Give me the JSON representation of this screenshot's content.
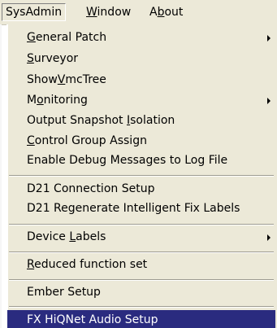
{
  "menubar": {
    "sysadmin": {
      "pre": "SysAdmin",
      "u": "",
      "post": ""
    },
    "window": {
      "pre": "",
      "u": "W",
      "post": "indow"
    },
    "about": {
      "pre": "A",
      "u": "b",
      "post": "out"
    }
  },
  "menu": {
    "general_patch": {
      "pre": "",
      "u": "G",
      "post": "eneral Patch",
      "submenu": true
    },
    "surveyor": {
      "pre": "",
      "u": "S",
      "post": "urveyor"
    },
    "show_vmc_tree": {
      "pre": "Show",
      "u": "V",
      "post": "mcTree"
    },
    "monitoring": {
      "pre": "M",
      "u": "o",
      "post": "nitoring",
      "submenu": true
    },
    "output_snapshot_isolation": {
      "pre": "Output Snapshot ",
      "u": "I",
      "post": "solation"
    },
    "control_group_assign": {
      "pre": "",
      "u": "C",
      "post": "ontrol Group Assign"
    },
    "enable_debug": {
      "pre": "Enable Debug Messages to Log File",
      "u": "",
      "post": ""
    },
    "d21_connection_setup": {
      "pre": "D21 Connection Setup",
      "u": "",
      "post": ""
    },
    "d21_regenerate": {
      "pre": "D21 Regenerate Intelligent Fix Labels",
      "u": "",
      "post": ""
    },
    "device_labels": {
      "pre": "Device ",
      "u": "L",
      "post": "abels",
      "submenu": true
    },
    "reduced_function_set": {
      "pre": "",
      "u": "R",
      "post": "educed function set"
    },
    "ember_setup": {
      "pre": "Ember Setup",
      "u": "",
      "post": ""
    },
    "fx_hiqnet": {
      "pre": "FX HiQNet Audio Setup",
      "u": "",
      "post": ""
    }
  },
  "colors": {
    "menu_bg": "#ece9d8",
    "highlight_bg": "#2a2b7f",
    "highlight_fg": "#ffffff"
  }
}
